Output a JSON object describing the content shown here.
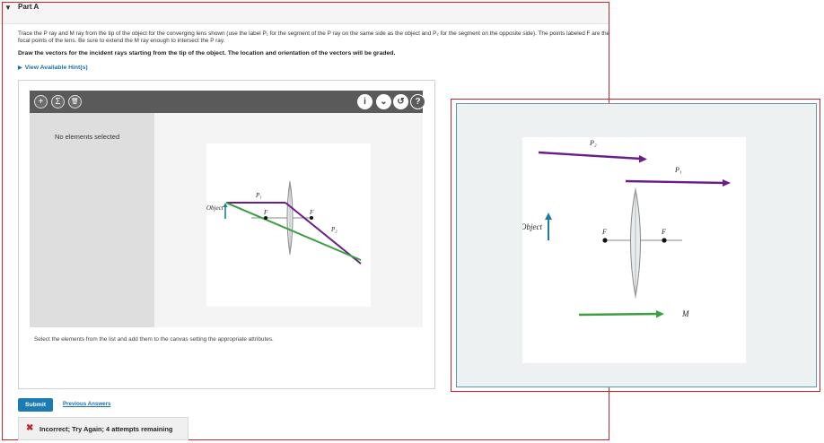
{
  "part": {
    "toggle_icon": "▼",
    "title": "Part A"
  },
  "instructions": {
    "line1": "Trace the P ray and M ray from the tip of the object for the converging lens shown (use the label P₁ for the segment of the P ray on the same side as the object and P₂ for the segment on the opposite side). The points labeled F are the focal points of the lens. Be sure to extend the M ray enough to intersect the P ray.",
    "line2": "Draw the vectors for the incident rays starting from the tip of the object. The location and orientation of the vectors will be graded."
  },
  "hints": {
    "icon": "▶",
    "label": "View Available Hint(s)"
  },
  "toolbar": {
    "add_icon": "+",
    "sum_icon": "Σ",
    "delete_icon": "🗑",
    "info_icon": "i",
    "chevron_icon": "⌄",
    "reset_icon": "↺",
    "help_icon": "?"
  },
  "elements_panel": {
    "empty_text": "No elements selected"
  },
  "canvas": {
    "select_msg": "Select the elements from the list and add them to the canvas setting the appropriate attributes."
  },
  "figure_labels": {
    "object": "Object",
    "f_left": "F",
    "f_right": "F",
    "p1": "P₁",
    "p2": "P₂",
    "m": "M"
  },
  "actions": {
    "submit": "Submit",
    "previous_answers": "Previous Answers"
  },
  "feedback": {
    "icon": "✖",
    "text": "Incorrect; Try Again; 4 attempts remaining"
  },
  "colors": {
    "purple": "#6b1e8a",
    "green": "#3aa041",
    "teal": "#1a7f9a",
    "accent_red": "#c8262c",
    "submit_blue": "#1c7bb3"
  }
}
